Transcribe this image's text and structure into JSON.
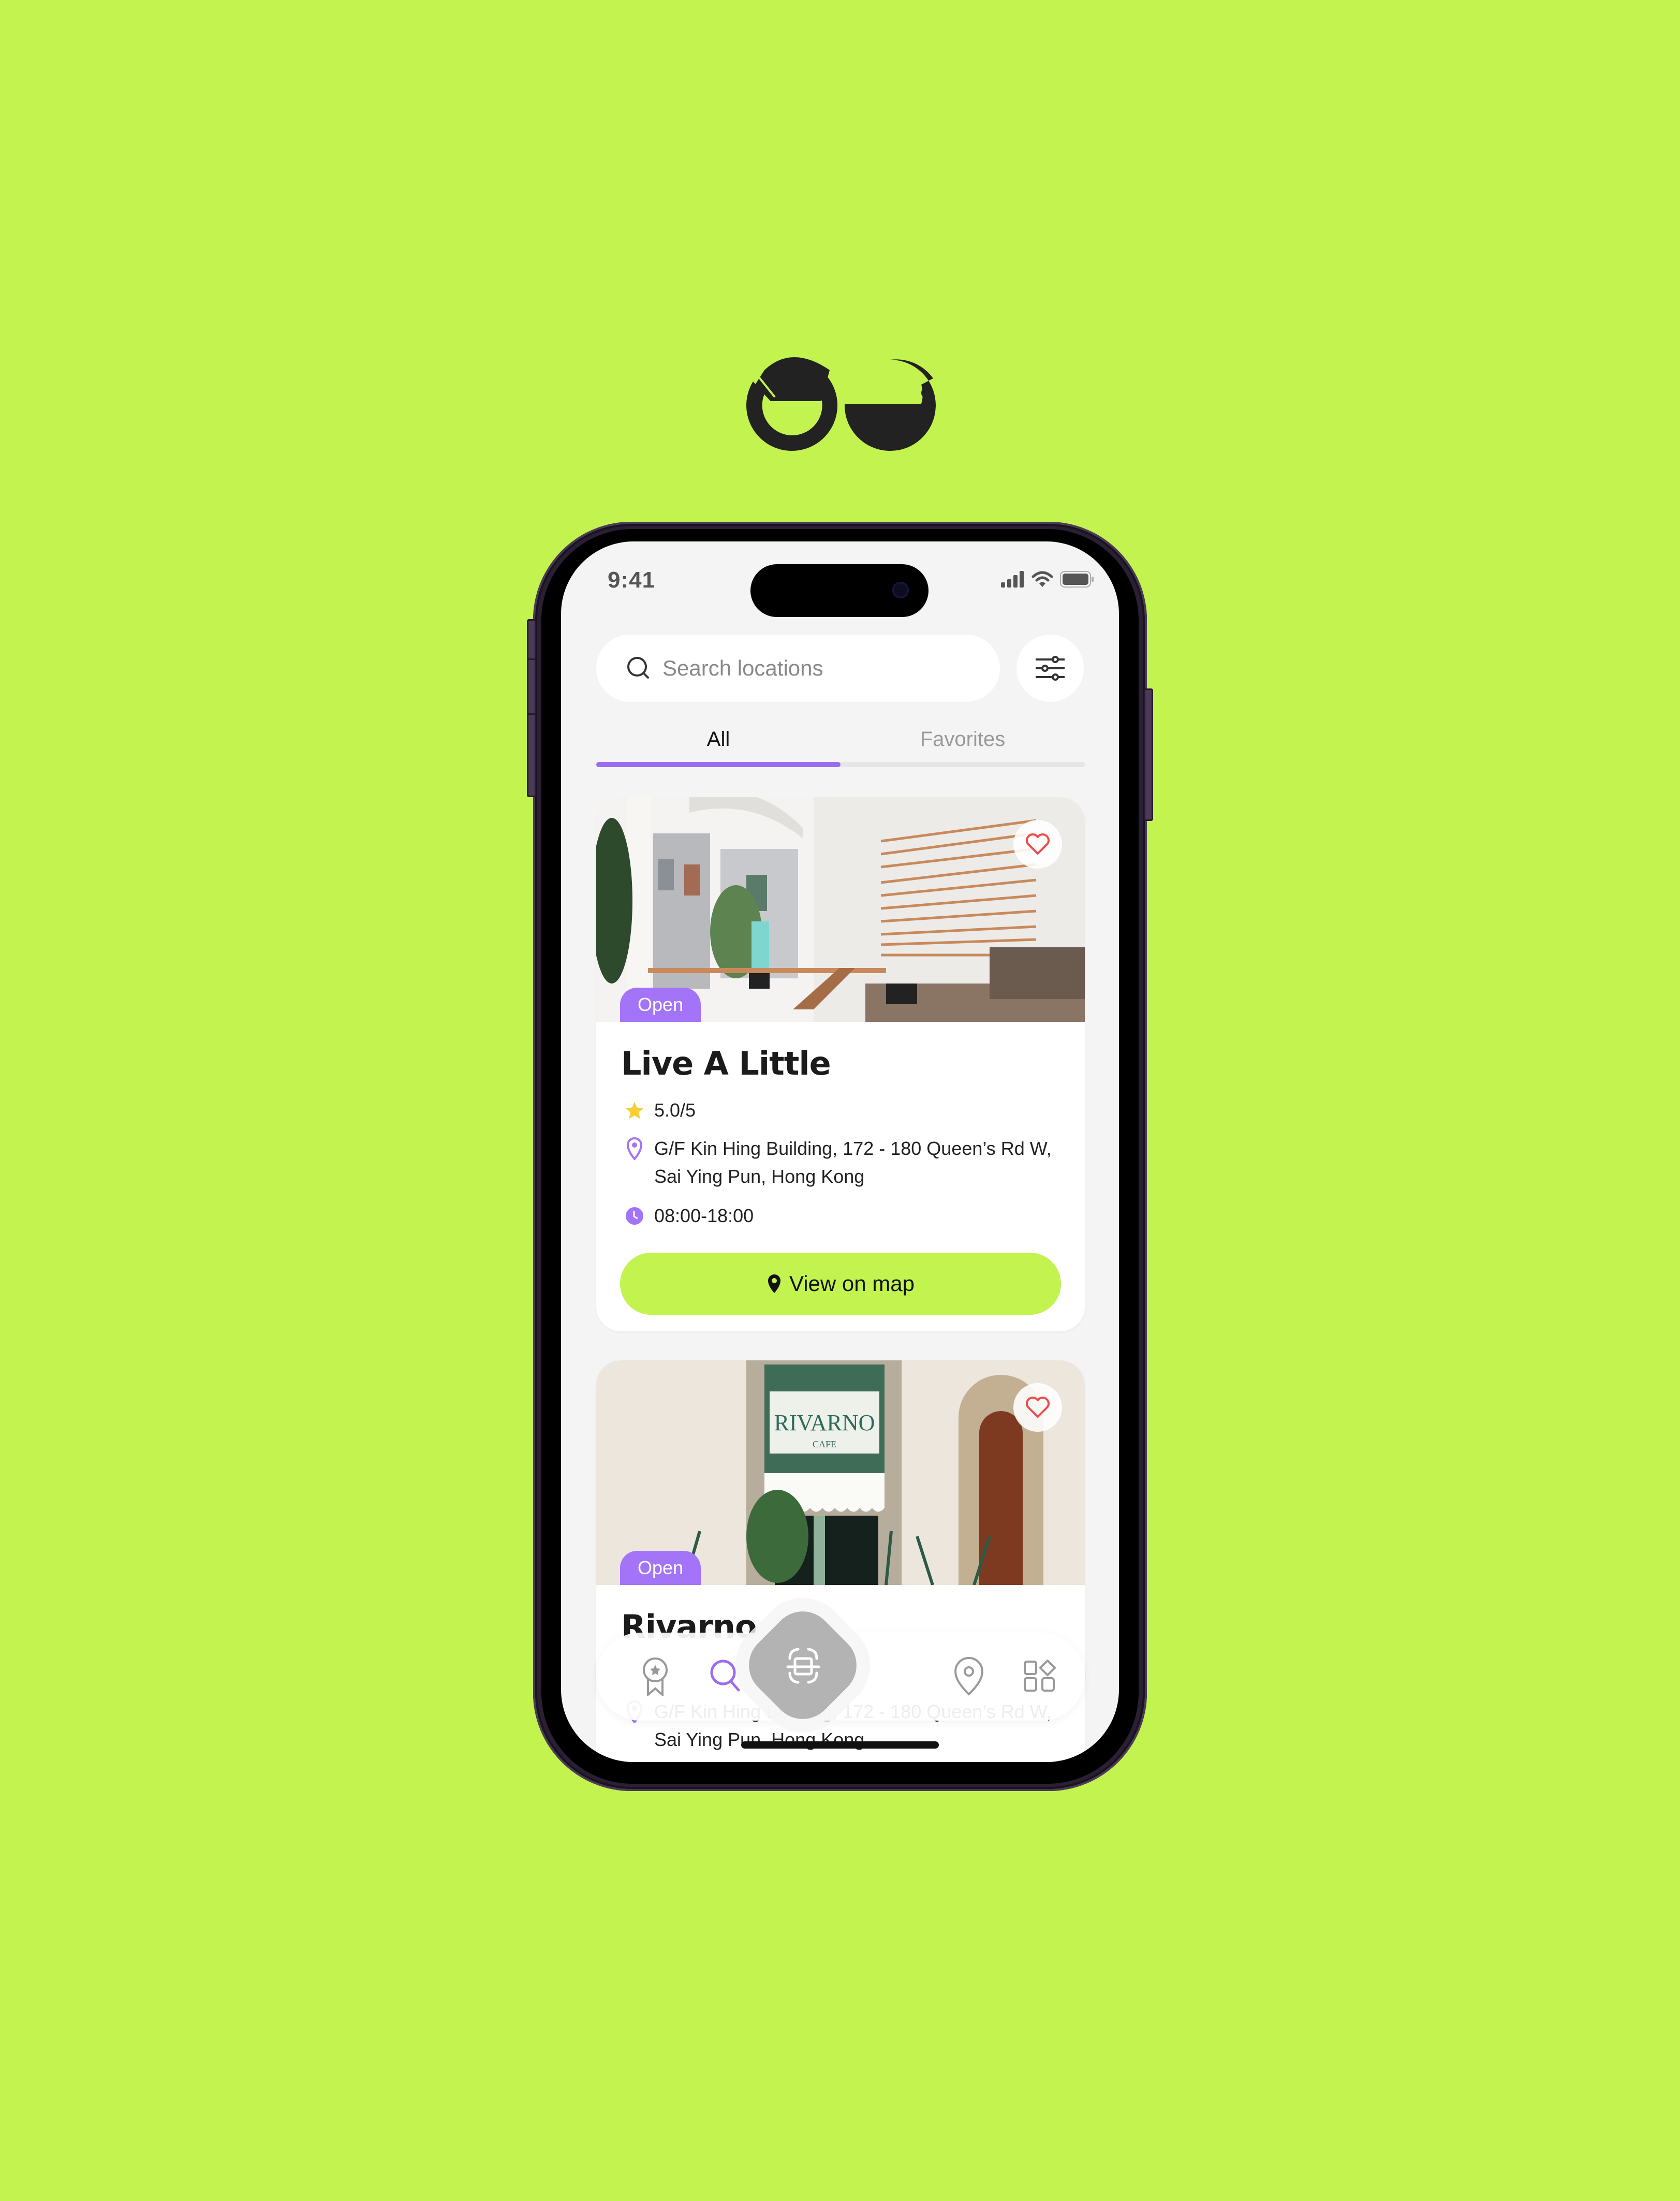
{
  "brand": {
    "logo_icon": "cafe-cups-logo",
    "accent_color": "#c3f34e",
    "purple": "#a374f7"
  },
  "status_bar": {
    "time": "9:41",
    "icons": [
      "signal-icon",
      "wifi-icon",
      "battery-icon"
    ]
  },
  "search": {
    "placeholder": "Search locations",
    "icon": "search-icon",
    "filter_icon": "sliders-icon"
  },
  "tabs": [
    {
      "label": "All",
      "active": true
    },
    {
      "label": "Favorites",
      "active": false
    }
  ],
  "tab_progress": 0.5,
  "cafes": [
    {
      "name": "Live A Little",
      "status": "Open",
      "rating": "5.0/5",
      "address": "G/F Kin Hing Building, 172 - 180 Queen’s Rd W, Sai Ying Pun, Hong Kong",
      "hours": "08:00-18:00",
      "favorited": false,
      "button_label": "View on map"
    },
    {
      "name": "Rivarno",
      "status": "Open",
      "sign_text": "RIVARNO",
      "sign_sub": "CAFE",
      "address": "G/F Kin Hing Building, 172 - 180 Queen’s Rd W, Sai Ying Pun, Hong Kong",
      "favorited": false
    }
  ],
  "bottom_nav": [
    {
      "name": "rewards",
      "icon": "award-ribbon-icon",
      "active": false
    },
    {
      "name": "search",
      "icon": "search-icon",
      "active": true
    },
    {
      "name": "scan",
      "icon": "scan-icon",
      "active": false
    },
    {
      "name": "map",
      "icon": "map-pin-icon",
      "active": false
    },
    {
      "name": "more",
      "icon": "apps-grid-icon",
      "active": false
    }
  ]
}
